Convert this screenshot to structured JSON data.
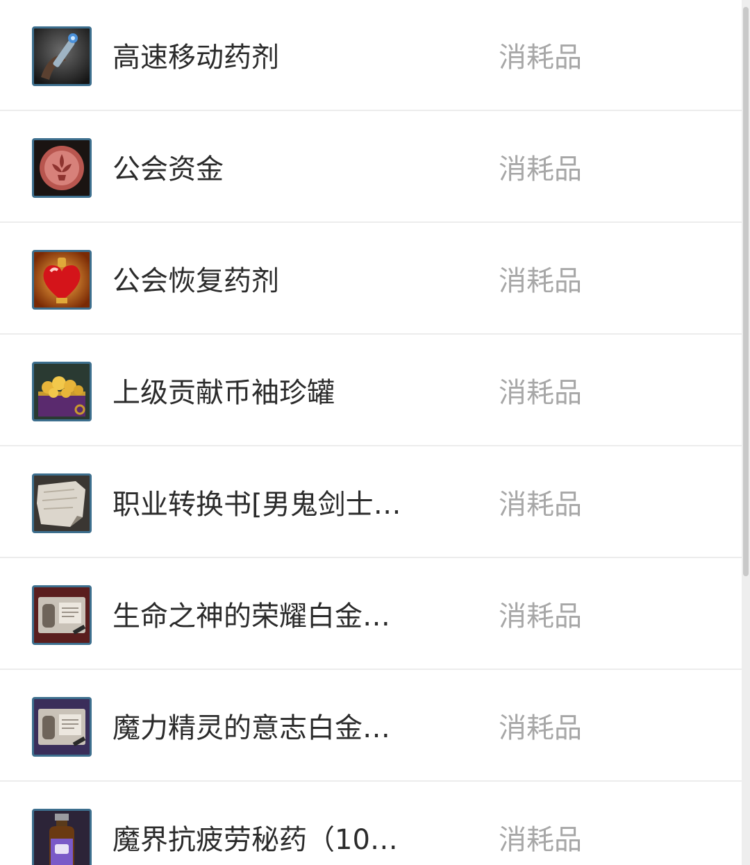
{
  "items": [
    {
      "name": "高速移动药剂",
      "type": "消耗品",
      "icon": "speed-potion-icon"
    },
    {
      "name": "公会资金",
      "type": "消耗品",
      "icon": "guild-coin-icon"
    },
    {
      "name": "公会恢复药剂",
      "type": "消耗品",
      "icon": "heart-potion-icon"
    },
    {
      "name": "上级贡献币袖珍罐",
      "type": "消耗品",
      "icon": "gold-chest-icon"
    },
    {
      "name": "职业转换书[男鬼剑士…",
      "type": "消耗品",
      "icon": "scroll-icon"
    },
    {
      "name": "生命之神的荣耀白金…",
      "type": "消耗品",
      "icon": "platinum-box-icon"
    },
    {
      "name": "魔力精灵的意志白金…",
      "type": "消耗品",
      "icon": "platinum-box-icon"
    },
    {
      "name": "魔界抗疲劳秘药（10…",
      "type": "消耗品",
      "icon": "medicine-bottle-icon"
    }
  ],
  "colors": {
    "icon_border": "#3d6f8e",
    "name_text": "#2b2b2b",
    "type_text": "#a7a7a7",
    "divider": "#ececec"
  }
}
